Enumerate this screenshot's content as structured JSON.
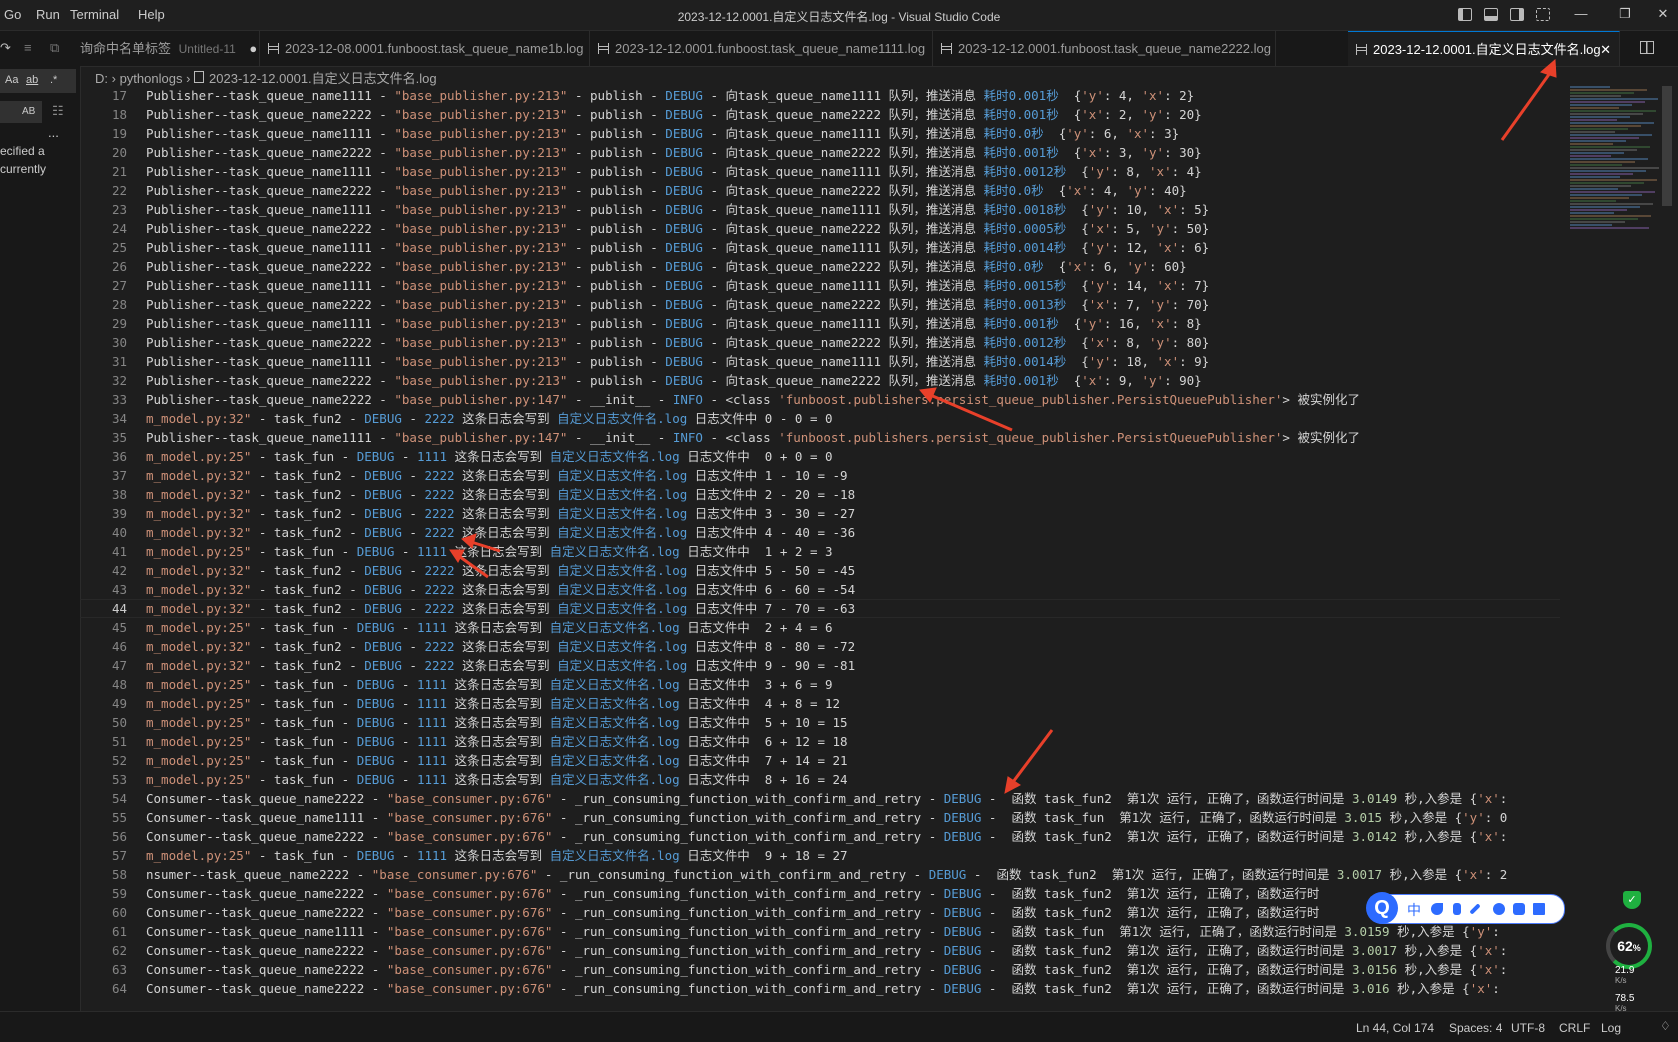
{
  "titlebar": {
    "menus": [
      "Go",
      "Run",
      "Terminal",
      "Help"
    ],
    "title": "2023-12-12.0001.自定义日志文件名.log - Visual Studio Code"
  },
  "sidebar": {
    "search_options": [
      "Aa",
      "ab",
      ".*"
    ],
    "preserve_case": "AB",
    "more": "...",
    "message_line1": "ecified a",
    "message_line2": "currently"
  },
  "tabs": [
    {
      "label": "询命中名单标签",
      "suffix": "Untitled-11",
      "dirty": true
    },
    {
      "label": "2023-12-08.0001.funboost.task_queue_name1b.log"
    },
    {
      "label": "2023-12-12.0001.funboost.task_queue_name1111.log"
    },
    {
      "label": "2023-12-12.0001.funboost.task_queue_name2222.log"
    },
    {
      "label": "2023-12-12.0001.自定义日志文件名.log",
      "active": true
    }
  ],
  "breadcrumb": {
    "drive": "D: ",
    "folder": "pythonlogs",
    "file": "2023-12-12.0001.自定义日志文件名.log"
  },
  "editor": {
    "current_line": 44,
    "lines": [
      {
        "n": 17,
        "t": "Publisher--task_queue_name1111 - \"base_publisher.py:213\" - publish - DEBUG - 向task_queue_name1111 队列，推送消息 耗时0.001秒  {'y': 4, 'x': 2}"
      },
      {
        "n": 18,
        "t": "Publisher--task_queue_name2222 - \"base_publisher.py:213\" - publish - DEBUG - 向task_queue_name2222 队列，推送消息 耗时0.001秒  {'x': 2, 'y': 20}"
      },
      {
        "n": 19,
        "t": "Publisher--task_queue_name1111 - \"base_publisher.py:213\" - publish - DEBUG - 向task_queue_name1111 队列，推送消息 耗时0.0秒  {'y': 6, 'x': 3}"
      },
      {
        "n": 20,
        "t": "Publisher--task_queue_name2222 - \"base_publisher.py:213\" - publish - DEBUG - 向task_queue_name2222 队列，推送消息 耗时0.001秒  {'x': 3, 'y': 30}"
      },
      {
        "n": 21,
        "t": "Publisher--task_queue_name1111 - \"base_publisher.py:213\" - publish - DEBUG - 向task_queue_name1111 队列，推送消息 耗时0.0012秒  {'y': 8, 'x': 4}"
      },
      {
        "n": 22,
        "t": "Publisher--task_queue_name2222 - \"base_publisher.py:213\" - publish - DEBUG - 向task_queue_name2222 队列，推送消息 耗时0.0秒  {'x': 4, 'y': 40}"
      },
      {
        "n": 23,
        "t": "Publisher--task_queue_name1111 - \"base_publisher.py:213\" - publish - DEBUG - 向task_queue_name1111 队列，推送消息 耗时0.0018秒  {'y': 10, 'x': 5}"
      },
      {
        "n": 24,
        "t": "Publisher--task_queue_name2222 - \"base_publisher.py:213\" - publish - DEBUG - 向task_queue_name2222 队列，推送消息 耗时0.0005秒  {'x': 5, 'y': 50}"
      },
      {
        "n": 25,
        "t": "Publisher--task_queue_name1111 - \"base_publisher.py:213\" - publish - DEBUG - 向task_queue_name1111 队列，推送消息 耗时0.0014秒  {'y': 12, 'x': 6}"
      },
      {
        "n": 26,
        "t": "Publisher--task_queue_name2222 - \"base_publisher.py:213\" - publish - DEBUG - 向task_queue_name2222 队列，推送消息 耗时0.0秒  {'x': 6, 'y': 60}"
      },
      {
        "n": 27,
        "t": "Publisher--task_queue_name1111 - \"base_publisher.py:213\" - publish - DEBUG - 向task_queue_name1111 队列，推送消息 耗时0.0015秒  {'y': 14, 'x': 7}"
      },
      {
        "n": 28,
        "t": "Publisher--task_queue_name2222 - \"base_publisher.py:213\" - publish - DEBUG - 向task_queue_name2222 队列，推送消息 耗时0.0013秒  {'x': 7, 'y': 70}"
      },
      {
        "n": 29,
        "t": "Publisher--task_queue_name1111 - \"base_publisher.py:213\" - publish - DEBUG - 向task_queue_name1111 队列，推送消息 耗时0.001秒  {'y': 16, 'x': 8}"
      },
      {
        "n": 30,
        "t": "Publisher--task_queue_name2222 - \"base_publisher.py:213\" - publish - DEBUG - 向task_queue_name2222 队列，推送消息 耗时0.0012秒  {'x': 8, 'y': 80}"
      },
      {
        "n": 31,
        "t": "Publisher--task_queue_name1111 - \"base_publisher.py:213\" - publish - DEBUG - 向task_queue_name1111 队列，推送消息 耗时0.0014秒  {'y': 18, 'x': 9}"
      },
      {
        "n": 32,
        "t": "Publisher--task_queue_name2222 - \"base_publisher.py:213\" - publish - DEBUG - 向task_queue_name2222 队列，推送消息 耗时0.001秒  {'x': 9, 'y': 90}"
      },
      {
        "n": 33,
        "t": "Publisher--task_queue_name2222 - \"base_publisher.py:147\" - __init__ - INFO - <class 'funboost.publishers.persist_queue_publisher.PersistQueuePublisher'> 被实例化了"
      },
      {
        "n": 34,
        "t": "m_model.py:32\" - task_fun2 - DEBUG - 2222 这条日志会写到 自定义日志文件名.log 日志文件中 0 - 0 = 0"
      },
      {
        "n": 35,
        "t": "Publisher--task_queue_name1111 - \"base_publisher.py:147\" - __init__ - INFO - <class 'funboost.publishers.persist_queue_publisher.PersistQueuePublisher'> 被实例化了"
      },
      {
        "n": 36,
        "t": "m_model.py:25\" - task_fun - DEBUG - 1111 这条日志会写到 自定义日志文件名.log 日志文件中  0 + 0 = 0"
      },
      {
        "n": 37,
        "t": "m_model.py:32\" - task_fun2 - DEBUG - 2222 这条日志会写到 自定义日志文件名.log 日志文件中 1 - 10 = -9"
      },
      {
        "n": 38,
        "t": "m_model.py:32\" - task_fun2 - DEBUG - 2222 这条日志会写到 自定义日志文件名.log 日志文件中 2 - 20 = -18"
      },
      {
        "n": 39,
        "t": "m_model.py:32\" - task_fun2 - DEBUG - 2222 这条日志会写到 自定义日志文件名.log 日志文件中 3 - 30 = -27"
      },
      {
        "n": 40,
        "t": "m_model.py:32\" - task_fun2 - DEBUG - 2222 这条日志会写到 自定义日志文件名.log 日志文件中 4 - 40 = -36"
      },
      {
        "n": 41,
        "t": "m_model.py:25\" - task_fun - DEBUG - 1111 这条日志会写到 自定义日志文件名.log 日志文件中  1 + 2 = 3"
      },
      {
        "n": 42,
        "t": "m_model.py:32\" - task_fun2 - DEBUG - 2222 这条日志会写到 自定义日志文件名.log 日志文件中 5 - 50 = -45"
      },
      {
        "n": 43,
        "t": "m_model.py:32\" - task_fun2 - DEBUG - 2222 这条日志会写到 自定义日志文件名.log 日志文件中 6 - 60 = -54"
      },
      {
        "n": 44,
        "t": "m_model.py:32\" - task_fun2 - DEBUG - 2222 这条日志会写到 自定义日志文件名.log 日志文件中 7 - 70 = -63"
      },
      {
        "n": 45,
        "t": "m_model.py:25\" - task_fun - DEBUG - 1111 这条日志会写到 自定义日志文件名.log 日志文件中  2 + 4 = 6"
      },
      {
        "n": 46,
        "t": "m_model.py:32\" - task_fun2 - DEBUG - 2222 这条日志会写到 自定义日志文件名.log 日志文件中 8 - 80 = -72"
      },
      {
        "n": 47,
        "t": "m_model.py:32\" - task_fun2 - DEBUG - 2222 这条日志会写到 自定义日志文件名.log 日志文件中 9 - 90 = -81"
      },
      {
        "n": 48,
        "t": "m_model.py:25\" - task_fun - DEBUG - 1111 这条日志会写到 自定义日志文件名.log 日志文件中  3 + 6 = 9"
      },
      {
        "n": 49,
        "t": "m_model.py:25\" - task_fun - DEBUG - 1111 这条日志会写到 自定义日志文件名.log 日志文件中  4 + 8 = 12"
      },
      {
        "n": 50,
        "t": "m_model.py:25\" - task_fun - DEBUG - 1111 这条日志会写到 自定义日志文件名.log 日志文件中  5 + 10 = 15"
      },
      {
        "n": 51,
        "t": "m_model.py:25\" - task_fun - DEBUG - 1111 这条日志会写到 自定义日志文件名.log 日志文件中  6 + 12 = 18"
      },
      {
        "n": 52,
        "t": "m_model.py:25\" - task_fun - DEBUG - 1111 这条日志会写到 自定义日志文件名.log 日志文件中  7 + 14 = 21"
      },
      {
        "n": 53,
        "t": "m_model.py:25\" - task_fun - DEBUG - 1111 这条日志会写到 自定义日志文件名.log 日志文件中  8 + 16 = 24"
      },
      {
        "n": 54,
        "t": "Consumer--task_queue_name2222 - \"base_consumer.py:676\" - _run_consuming_function_with_confirm_and_retry - DEBUG -  函数 task_fun2  第1次 运行, 正确了，函数运行时间是 3.0149 秒,入参是 {'x':"
      },
      {
        "n": 55,
        "t": "Consumer--task_queue_name1111 - \"base_consumer.py:676\" - _run_consuming_function_with_confirm_and_retry - DEBUG -  函数 task_fun  第1次 运行, 正确了，函数运行时间是 3.015 秒,入参是 {'y': 0"
      },
      {
        "n": 56,
        "t": "Consumer--task_queue_name2222 - \"base_consumer.py:676\" - _run_consuming_function_with_confirm_and_retry - DEBUG -  函数 task_fun2  第1次 运行, 正确了，函数运行时间是 3.0142 秒,入参是 {'x':"
      },
      {
        "n": 57,
        "t": "m_model.py:25\" - task_fun - DEBUG - 1111 这条日志会写到 自定义日志文件名.log 日志文件中  9 + 18 = 27"
      },
      {
        "n": 58,
        "t": "nsumer--task_queue_name2222 - \"base_consumer.py:676\" - _run_consuming_function_with_confirm_and_retry - DEBUG -  函数 task_fun2  第1次 运行, 正确了，函数运行时间是 3.0017 秒,入参是 {'x': 2"
      },
      {
        "n": 59,
        "t": "Consumer--task_queue_name2222 - \"base_consumer.py:676\" - _run_consuming_function_with_confirm_and_retry - DEBUG -  函数 task_fun2  第1次 运行, 正确了，函数运行时"
      },
      {
        "n": 60,
        "t": "Consumer--task_queue_name2222 - \"base_consumer.py:676\" - _run_consuming_function_with_confirm_and_retry - DEBUG -  函数 task_fun2  第1次 运行, 正确了，函数运行时"
      },
      {
        "n": 61,
        "t": "Consumer--task_queue_name1111 - \"base_consumer.py:676\" - _run_consuming_function_with_confirm_and_retry - DEBUG -  函数 task_fun  第1次 运行, 正确了，函数运行时间是 3.0159 秒,入参是 {'y':"
      },
      {
        "n": 62,
        "t": "Consumer--task_queue_name2222 - \"base_consumer.py:676\" - _run_consuming_function_with_confirm_and_retry - DEBUG -  函数 task_fun2  第1次 运行, 正确了，函数运行时间是 3.0017 秒,入参是 {'x':"
      },
      {
        "n": 63,
        "t": "Consumer--task_queue_name2222 - \"base_consumer.py:676\" - _run_consuming_function_with_confirm_and_retry - DEBUG -  函数 task_fun2  第1次 运行, 正确了，函数运行时间是 3.0156 秒,入参是 {'x':"
      },
      {
        "n": 64,
        "t": "Consumer--task_queue_name2222 - \"base_consumer.py:676\" - _run_consuming_function_with_confirm_and_retry - DEBUG -  函数 task_fun2  第1次 运行, 正确了，函数运行时间是 3.016 秒,入参是 {'x':"
      }
    ]
  },
  "statusbar": {
    "position": "Ln 44, Col 174",
    "spaces": "Spaces: 4",
    "encoding": "UTF-8",
    "eol": "CRLF",
    "language": "Log"
  },
  "ime": {
    "logo": "Q",
    "mode": "中"
  },
  "monitor": {
    "cpu_percent": "62",
    "cpu_unit": "%",
    "up_speed": "21.9",
    "up_unit": "K/s",
    "down_speed": "78.5",
    "down_unit": "K/s"
  },
  "colors": {
    "accent": "#0078d4",
    "string": "#ce9178",
    "link": "#569cd6",
    "number": "#b5cea8",
    "arrow": "#e8402a"
  }
}
